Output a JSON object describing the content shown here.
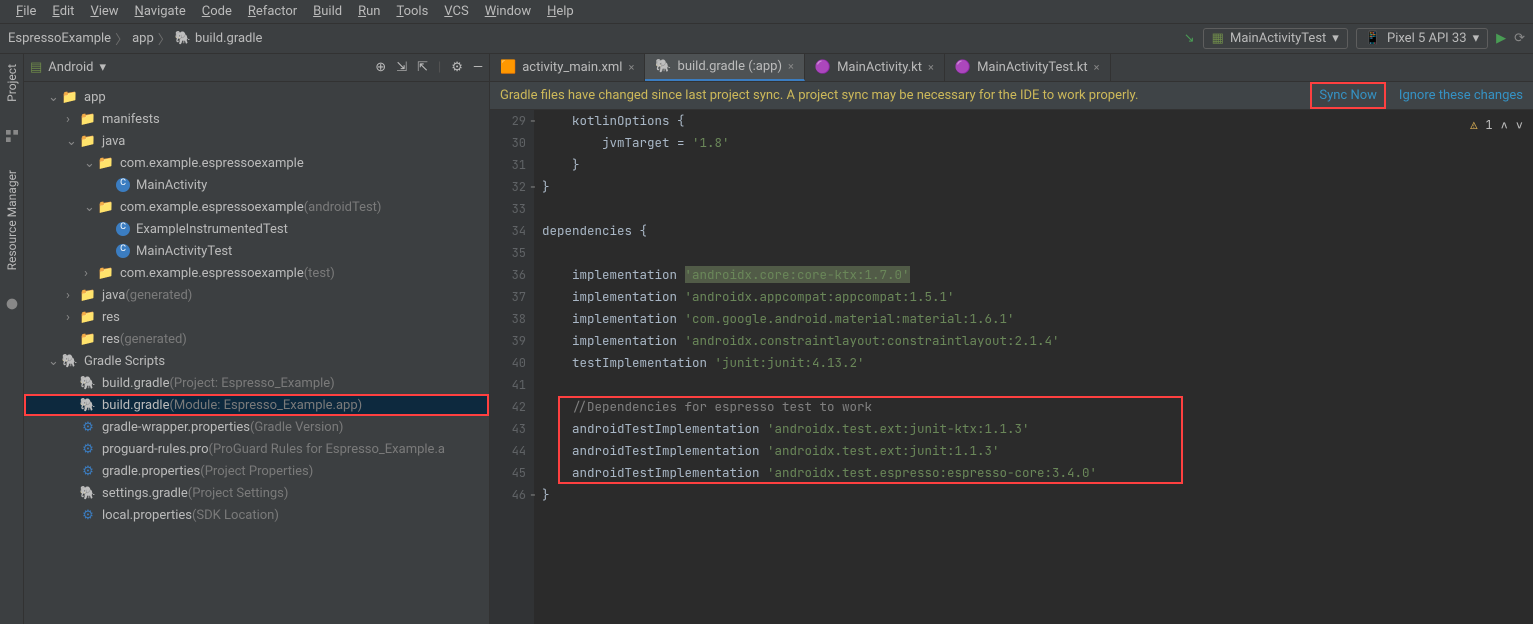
{
  "menubar": [
    "File",
    "Edit",
    "View",
    "Navigate",
    "Code",
    "Refactor",
    "Build",
    "Run",
    "Tools",
    "VCS",
    "Window",
    "Help"
  ],
  "breadcrumb": [
    "EspressoExample",
    "app",
    "build.gradle"
  ],
  "runConfig": "MainActivityTest",
  "device": "Pixel 5 API 33",
  "projectView": {
    "mode": "Android",
    "rails": {
      "project": "Project",
      "resource": "Resource Manager"
    }
  },
  "tree": [
    {
      "l": 1,
      "arrow": "v",
      "icon": "📁",
      "label": "app"
    },
    {
      "l": 2,
      "arrow": ">",
      "icon": "📁",
      "label": "manifests"
    },
    {
      "l": 2,
      "arrow": "v",
      "icon": "📁",
      "label": "java"
    },
    {
      "l": 3,
      "arrow": "v",
      "icon": "📁",
      "label": "com.example.espressoexample"
    },
    {
      "l": 4,
      "icon": "C",
      "iconColor": "#3b7dc1",
      "label": "MainActivity"
    },
    {
      "l": 3,
      "arrow": "v",
      "icon": "📁",
      "label": "com.example.espressoexample",
      "dim": "(androidTest)"
    },
    {
      "l": 4,
      "icon": "C",
      "iconColor": "#3b7dc1",
      "label": "ExampleInstrumentedTest"
    },
    {
      "l": 4,
      "icon": "C",
      "iconColor": "#3b7dc1",
      "label": "MainActivityTest"
    },
    {
      "l": 3,
      "arrow": ">",
      "icon": "📁",
      "label": "com.example.espressoexample",
      "dim": "(test)"
    },
    {
      "l": 2,
      "arrow": ">",
      "icon": "📁",
      "label": "java",
      "dim": "(generated)",
      "iconColor": "#6e8a4a"
    },
    {
      "l": 2,
      "arrow": ">",
      "icon": "📁",
      "label": "res",
      "iconColor": "#6e8a4a"
    },
    {
      "l": 2,
      "icon": "📁",
      "label": "res",
      "dim": "(generated)",
      "iconColor": "#6e8a4a"
    },
    {
      "l": 1,
      "arrow": "v",
      "icon": "🐘",
      "label": "Gradle Scripts"
    },
    {
      "l": 2,
      "icon": "🐘",
      "label": "build.gradle",
      "dim": "(Project: Espresso_Example)"
    },
    {
      "l": 2,
      "icon": "🐘",
      "label": "build.gradle",
      "dim": "(Module: Espresso_Example.app)",
      "selected": true,
      "redbox": true
    },
    {
      "l": 2,
      "icon": "⚙",
      "label": "gradle-wrapper.properties",
      "dim": "(Gradle Version)"
    },
    {
      "l": 2,
      "icon": "⚙",
      "label": "proguard-rules.pro",
      "dim": "(ProGuard Rules for Espresso_Example.a"
    },
    {
      "l": 2,
      "icon": "⚙",
      "label": "gradle.properties",
      "dim": "(Project Properties)"
    },
    {
      "l": 2,
      "icon": "🐘",
      "label": "settings.gradle",
      "dim": "(Project Settings)"
    },
    {
      "l": 2,
      "icon": "⚙",
      "label": "local.properties",
      "dim": "(SDK Location)"
    }
  ],
  "tabs": [
    {
      "label": "activity_main.xml",
      "icon": "xml"
    },
    {
      "label": "build.gradle (:app)",
      "icon": "gradle",
      "active": true
    },
    {
      "label": "MainActivity.kt",
      "icon": "kt"
    },
    {
      "label": "MainActivityTest.kt",
      "icon": "kt"
    }
  ],
  "notif": {
    "msg": "Gradle files have changed since last project sync. A project sync may be necessary for the IDE to work properly.",
    "sync": "Sync Now",
    "ignore": "Ignore these changes"
  },
  "warnings": "1",
  "code": {
    "start": 29,
    "lines": [
      {
        "n": 29,
        "t": "    kotlinOptions {",
        "fold": "⊟"
      },
      {
        "n": 30,
        "t": "        jvmTarget = '1.8'",
        "jvmStr": true
      },
      {
        "n": 31,
        "t": "    }"
      },
      {
        "n": 32,
        "t": "}",
        "fold": "⊟"
      },
      {
        "n": 33,
        "t": ""
      },
      {
        "n": 34,
        "t": "dependencies {",
        "kw": "dependencies"
      },
      {
        "n": 35,
        "t": ""
      },
      {
        "n": 36,
        "impl": "implementation",
        "str": "'androidx.core:core-ktx:1.7.0'",
        "hl": true
      },
      {
        "n": 37,
        "impl": "implementation",
        "str": "'androidx.appcompat:appcompat:1.5.1'"
      },
      {
        "n": 38,
        "impl": "implementation",
        "str": "'com.google.android.material:material:1.6.1'"
      },
      {
        "n": 39,
        "impl": "implementation",
        "str": "'androidx.constraintlayout:constraintlayout:2.1.4'"
      },
      {
        "n": 40,
        "impl": "testImplementation",
        "str": "'junit:junit:4.13.2'"
      },
      {
        "n": 41,
        "t": ""
      },
      {
        "n": 42,
        "cmt": "    //Dependencies for espresso test to work"
      },
      {
        "n": 43,
        "impl": "androidTestImplementation",
        "str": "'androidx.test.ext:junit-ktx:1.1.3'"
      },
      {
        "n": 44,
        "impl": "androidTestImplementation",
        "str": "'androidx.test.ext:junit:1.1.3'"
      },
      {
        "n": 45,
        "impl": "androidTestImplementation",
        "str": "'androidx.test.espresso:espresso-core:3.4.0'"
      },
      {
        "n": 46,
        "t": "}",
        "fold": "⊟"
      }
    ],
    "redbox": {
      "startLine": 42,
      "endLine": 45
    }
  }
}
